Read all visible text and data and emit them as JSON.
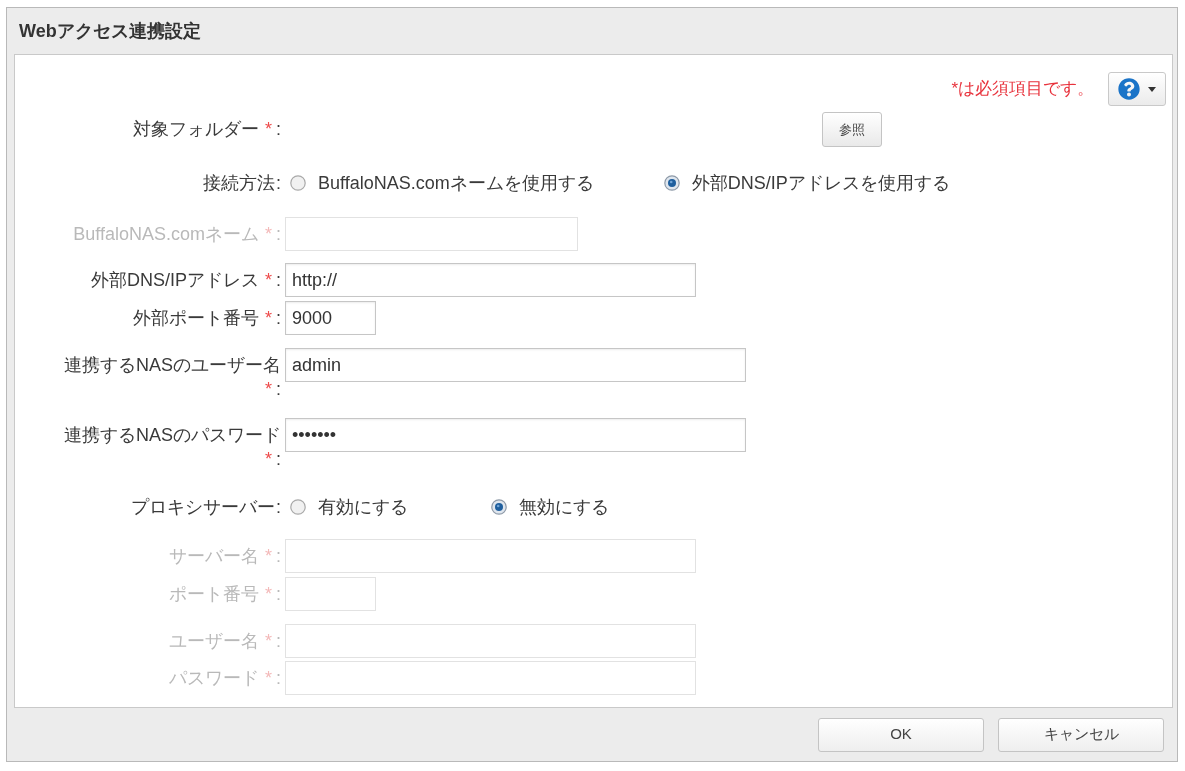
{
  "window": {
    "title": "Webアクセス連携設定"
  },
  "required_note": "*は必須項目です。",
  "form": {
    "rows": [
      {
        "kind": "browse",
        "label": "対象フォルダー",
        "required_mark": "*",
        "colon": ":",
        "disabled": false,
        "button": "参照"
      },
      {
        "kind": "radio",
        "label": "接続方法",
        "colon": ":",
        "disabled": false,
        "options": [
          {
            "label": "BuffaloNAS.comネームを使用する",
            "selected": false
          },
          {
            "label": "外部DNS/IPアドレスを使用する",
            "selected": true
          }
        ]
      },
      {
        "kind": "field",
        "label": "BuffaloNAS.comネーム",
        "required_mark": "*",
        "colon": ":",
        "disabled": true
      },
      {
        "kind": "field",
        "label": "外部DNS/IPアドレス",
        "required_mark": "*",
        "colon": ":",
        "disabled": false,
        "value": "http://"
      },
      {
        "kind": "field",
        "label": "外部ポート番号",
        "required_mark": "*",
        "colon": ":",
        "disabled": false,
        "value": "9000"
      },
      {
        "kind": "field",
        "label": "連携するNASのユーザー名",
        "required_mark": "*",
        "colon": ":",
        "disabled": false,
        "value": "admin"
      },
      {
        "kind": "field",
        "label": "連携するNASのパスワード",
        "required_mark": "*",
        "colon": ":",
        "disabled": false,
        "value": "•••••••"
      },
      {
        "kind": "radio",
        "label": "プロキシサーバー",
        "colon": ":",
        "disabled": false,
        "options": [
          {
            "label": "有効にする",
            "selected": false
          },
          {
            "label": "無効にする",
            "selected": true
          }
        ]
      },
      {
        "kind": "field",
        "label": "サーバー名",
        "required_mark": "*",
        "colon": ":",
        "disabled": true
      },
      {
        "kind": "field",
        "label": "ポート番号",
        "required_mark": "*",
        "colon": ":",
        "disabled": true
      },
      {
        "kind": "field",
        "label": "ユーザー名",
        "required_mark": "*",
        "colon": ":",
        "disabled": true
      },
      {
        "kind": "field",
        "label": "パスワード",
        "required_mark": "*",
        "colon": ":",
        "disabled": true
      }
    ]
  },
  "buttons": [
    "OK",
    "キャンセル"
  ]
}
